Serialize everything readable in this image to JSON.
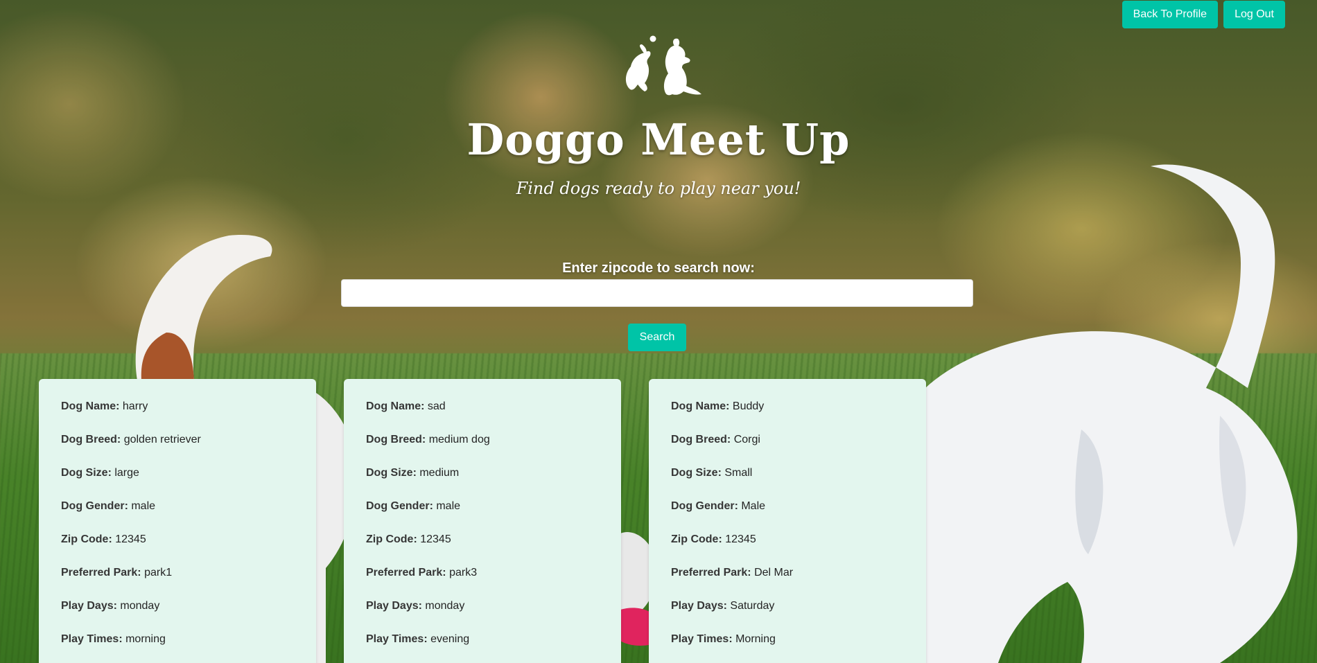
{
  "header": {
    "back_to_profile_label": "Back To Profile",
    "log_out_label": "Log Out"
  },
  "hero": {
    "title": "Doggo Meet Up",
    "subtitle": "Find dogs ready to play near you!"
  },
  "search": {
    "label": "Enter zipcode to search now:",
    "value": "",
    "placeholder": "",
    "button_label": "Search"
  },
  "field_labels": {
    "name": "Dog Name:",
    "breed": "Dog Breed:",
    "size": "Dog Size:",
    "gender": "Dog Gender:",
    "zip": "Zip Code:",
    "park": "Preferred Park:",
    "days": "Play Days:",
    "times": "Play Times:"
  },
  "dogs": [
    {
      "name": "harry",
      "breed": "golden retriever",
      "size": "large",
      "gender": "male",
      "zip": "12345",
      "park": "park1",
      "days": "monday",
      "times": "morning"
    },
    {
      "name": "sad",
      "breed": "medium dog",
      "size": "medium",
      "gender": "male",
      "zip": "12345",
      "park": "park3",
      "days": "monday",
      "times": "evening"
    },
    {
      "name": "Buddy",
      "breed": "Corgi",
      "size": "Small",
      "gender": "Male",
      "zip": "12345",
      "park": "Del Mar",
      "days": "Saturday",
      "times": "Morning"
    }
  ],
  "icons": {
    "logo": "dogs-playing-logo-icon"
  },
  "colors": {
    "accent": "#00c4a7",
    "card_bg": "#e3f6ee",
    "text": "#363636"
  }
}
